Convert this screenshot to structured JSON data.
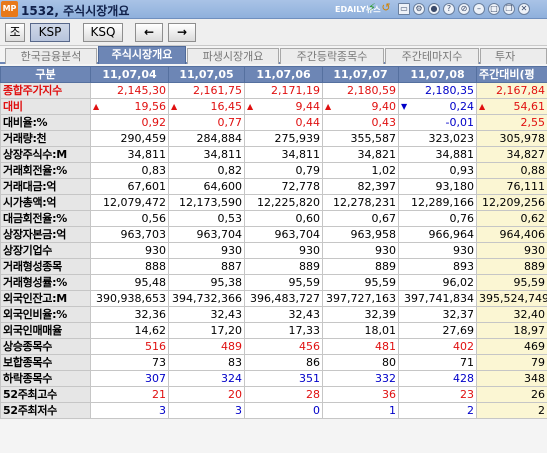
{
  "window": {
    "code_title": "1532, 주식시장개요",
    "app_icon_text": "MP",
    "brand": "EDAILY뉴스"
  },
  "toolbar": {
    "switch_label": "조",
    "ksp_label": "KSP",
    "ksq_label": "KSQ",
    "prev_arrow": "←",
    "next_arrow": "→"
  },
  "tabs": [
    "한국금융분석",
    "주식시장개요",
    "파생시장개요",
    "주간등락종목수",
    "주간테마지수",
    "투자"
  ],
  "active_tab_index": 1,
  "columns": [
    "구분",
    "11,07,04",
    "11,07,05",
    "11,07,06",
    "11,07,07",
    "11,07,08",
    "주간대비(평"
  ],
  "colors": {
    "header_bg": "#6d86b5",
    "up": "#e01010",
    "down": "#0000c8",
    "weekly_bg": "#fbf6d3",
    "label_bg": "#e6e6e6"
  },
  "rows": [
    {
      "label": "종합주가지수",
      "tone": "up",
      "values": [
        "2,145,30",
        "2,161,75",
        "2,171,19",
        "2,180,59",
        "2,180,35",
        "2,167,84"
      ],
      "tones": [
        "up",
        "up",
        "up",
        "up",
        "down",
        "up"
      ]
    },
    {
      "label": "대비",
      "tone": "up",
      "arrows": [
        "up",
        "up",
        "up",
        "up",
        "down",
        "up"
      ],
      "values": [
        "19,56",
        "16,45",
        "9,44",
        "9,40",
        "0,24",
        "54,61"
      ],
      "tones": [
        "up",
        "up",
        "up",
        "up",
        "down",
        "up"
      ]
    },
    {
      "label": "대비율:%",
      "values": [
        "0,92",
        "0,77",
        "0,44",
        "0,43",
        "-0,01",
        "2,55"
      ],
      "tones": [
        "up",
        "up",
        "up",
        "up",
        "down",
        "up"
      ]
    },
    {
      "label": "거래량:천",
      "values": [
        "290,459",
        "284,884",
        "275,939",
        "355,587",
        "323,023",
        "305,978"
      ]
    },
    {
      "label": "상장주식수:M",
      "values": [
        "34,811",
        "34,811",
        "34,811",
        "34,821",
        "34,881",
        "34,827"
      ]
    },
    {
      "label": "거래회전율:%",
      "values": [
        "0,83",
        "0,82",
        "0,79",
        "1,02",
        "0,93",
        "0,88"
      ]
    },
    {
      "label": "거래대금:억",
      "values": [
        "67,601",
        "64,600",
        "72,778",
        "82,397",
        "93,180",
        "76,111"
      ]
    },
    {
      "label": "시가총액:억",
      "values": [
        "12,079,472",
        "12,173,590",
        "12,225,820",
        "12,278,231",
        "12,289,166",
        "12,209,256"
      ]
    },
    {
      "label": "대금회전율:%",
      "values": [
        "0,56",
        "0,53",
        "0,60",
        "0,67",
        "0,76",
        "0,62"
      ]
    },
    {
      "label": "상장자본금:억",
      "values": [
        "963,703",
        "963,704",
        "963,704",
        "963,958",
        "966,964",
        "964,406"
      ]
    },
    {
      "label": "상장기업수",
      "values": [
        "930",
        "930",
        "930",
        "930",
        "930",
        "930"
      ]
    },
    {
      "label": "거래형성종목",
      "values": [
        "888",
        "887",
        "889",
        "889",
        "893",
        "889"
      ]
    },
    {
      "label": "거래형성률:%",
      "values": [
        "95,48",
        "95,38",
        "95,59",
        "95,59",
        "96,02",
        "95,59"
      ]
    },
    {
      "label": "외국인잔고:M",
      "values": [
        "390,938,653",
        "394,732,366",
        "396,483,727",
        "397,727,163",
        "397,741,834",
        "395,524,749"
      ]
    },
    {
      "label": "외국인비율:%",
      "values": [
        "32,36",
        "32,43",
        "32,43",
        "32,39",
        "32,37",
        "32,40"
      ]
    },
    {
      "label": "외국인매매율",
      "values": [
        "14,62",
        "17,20",
        "17,33",
        "18,01",
        "27,69",
        "18,97"
      ]
    },
    {
      "label": "상승종목수",
      "values": [
        "516",
        "489",
        "456",
        "481",
        "402",
        "469"
      ],
      "tones": [
        "up",
        "up",
        "up",
        "up",
        "up",
        ""
      ]
    },
    {
      "label": "보합종목수",
      "values": [
        "73",
        "83",
        "86",
        "80",
        "71",
        "79"
      ]
    },
    {
      "label": "하락종목수",
      "values": [
        "307",
        "324",
        "351",
        "332",
        "428",
        "348"
      ],
      "tones": [
        "down",
        "down",
        "down",
        "down",
        "down",
        ""
      ]
    },
    {
      "label": "52주최고수",
      "values": [
        "21",
        "20",
        "28",
        "36",
        "23",
        "26"
      ],
      "tones": [
        "up",
        "up",
        "up",
        "up",
        "up",
        ""
      ]
    },
    {
      "label": "52주최저수",
      "values": [
        "3",
        "3",
        "0",
        "1",
        "2",
        "2"
      ],
      "tones": [
        "down",
        "down",
        "down",
        "down",
        "down",
        ""
      ]
    }
  ]
}
